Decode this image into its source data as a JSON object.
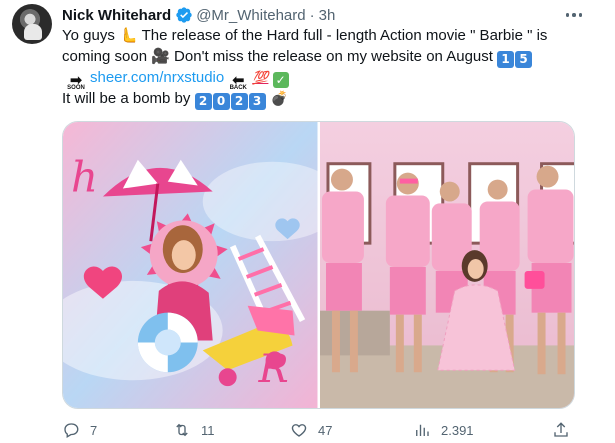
{
  "author": {
    "name": "Nick Whitehard",
    "handle": "@Mr_Whitehard",
    "separator": "·",
    "time": "3h"
  },
  "tweet": {
    "line1": "Yo guys 🫷 The release of the Hard full - length Action movie \" Barbie \" is",
    "line2_text": "coming soon 🎥 Don't miss the release on my website on August",
    "release_day_digits": [
      "1",
      "5"
    ],
    "soon_label": "SOON",
    "link": "sheer.com/nrxstudio",
    "back_label": "BACK",
    "hundred_emoji": "💯",
    "check_emoji": "✓",
    "line4_text": "It will be a bomb by",
    "year_digits": [
      "2",
      "0",
      "2",
      "3"
    ],
    "bomb_emoji": "💣"
  },
  "media": [
    {
      "alt_name": "barbie-collage-image"
    },
    {
      "alt_name": "group-photo-image"
    }
  ],
  "actions": {
    "replies": "7",
    "retweets": "11",
    "likes": "47",
    "views": "2.391"
  },
  "colors": {
    "link": "#1d9bf0",
    "secondary_text": "#536471",
    "verified": "#1d9bf0",
    "keycap": "#3a86d9"
  },
  "icons": [
    "verified-badge-icon",
    "more-icon",
    "reply-icon",
    "retweet-icon",
    "like-icon",
    "views-icon",
    "share-icon"
  ]
}
